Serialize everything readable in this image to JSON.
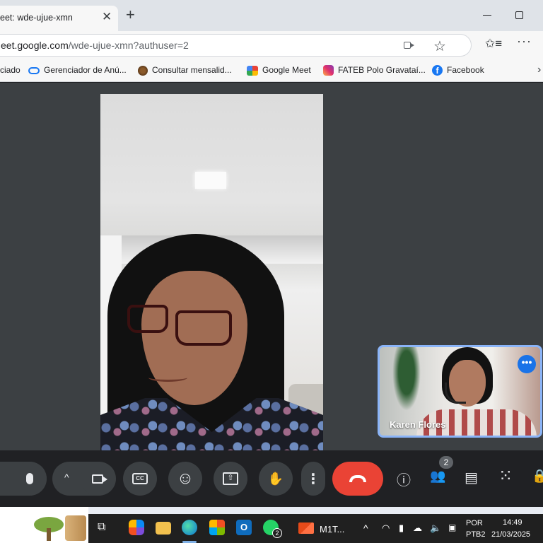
{
  "browser": {
    "tab_title": "eet: wde-ujue-xmn",
    "tab_close": "✕",
    "new_tab": "+",
    "url_host": "eet.google.com",
    "url_path": "/wde-ujue-xmn?authuser=2",
    "star": "☆",
    "favorites": "✩≡",
    "menu": "···"
  },
  "bookmarks": [
    {
      "label": "ciado"
    },
    {
      "label": "Gerenciador de Anú..."
    },
    {
      "label": "Consultar mensalid..."
    },
    {
      "label": "Google Meet"
    },
    {
      "label": "FATEB Polo Gravataí..."
    },
    {
      "label": "Facebook"
    }
  ],
  "bookmarks_overflow": "›",
  "meet": {
    "pip_name": "Karen Flores",
    "pip_more": "•••",
    "participants_count": "2",
    "cc_label": "CC",
    "emoji": "☺",
    "present": "⇧",
    "raise_hand": "✋",
    "more": "⋮",
    "info": "ⓘ",
    "people": "👥",
    "chat": "▤",
    "activities": "⁙",
    "lock": "🔒",
    "chevron_up": "^"
  },
  "taskbar": {
    "task_view": "⧉",
    "app_label": "M1T...",
    "whatsapp_badge": "2",
    "tray_chevron": "^",
    "lang_top": "POR",
    "lang_bottom": "PTB2",
    "time": "14:49",
    "date": "21/03/2025"
  },
  "colors": {
    "meet_bg": "#3c4043",
    "control_bg": "#202124",
    "end_call": "#ea4335",
    "pip_border": "#8ab4f8",
    "accent": "#1a73e8"
  }
}
